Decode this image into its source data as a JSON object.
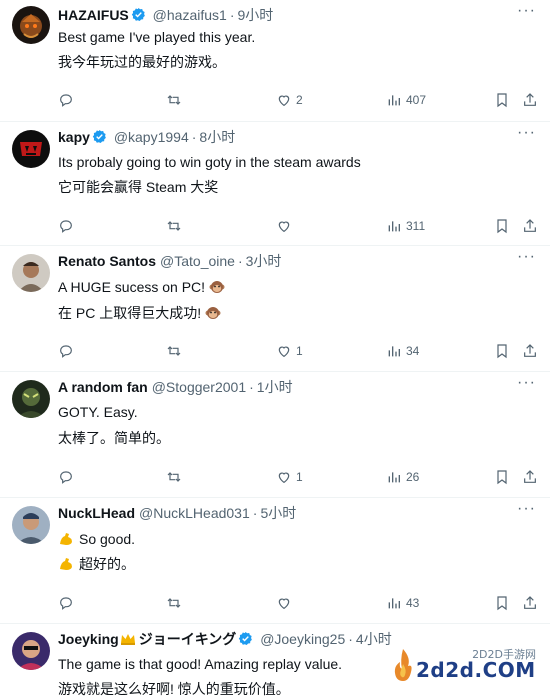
{
  "tweets": [
    {
      "name": "HAZAIFUS",
      "verified": true,
      "handle": "@hazaifus1",
      "time": "9小时",
      "text_en": "Best game I've played this year.",
      "text_zh": "我今年玩过的最好的游戏。",
      "likes": "2",
      "views": "407",
      "emoji": ""
    },
    {
      "name": "kapy",
      "verified": true,
      "handle": "@kapy1994",
      "time": "8小时",
      "text_en": "Its probaly going to win goty in the steam awards",
      "text_zh": "它可能会赢得 Steam 大奖",
      "likes": "",
      "views": "311",
      "emoji": ""
    },
    {
      "name": "Renato Santos",
      "verified": false,
      "handle": "@Tato_oine",
      "time": "3小时",
      "text_en": "A HUGE sucess on PC!",
      "text_zh": "在 PC 上取得巨大成功!",
      "likes": "1",
      "views": "34",
      "emoji": "monkey"
    },
    {
      "name": "A random fan",
      "verified": false,
      "handle": "@Stogger2001",
      "time": "1小时",
      "text_en": "GOTY. Easy.",
      "text_zh": "太棒了。简单的。",
      "likes": "1",
      "views": "26",
      "emoji": ""
    },
    {
      "name": "NuckLHead",
      "verified": false,
      "handle": "@NuckLHead031",
      "time": "5小时",
      "text_en": "So good.",
      "text_zh": "超好的。",
      "likes": "",
      "views": "43",
      "emoji": "flexed-biceps"
    },
    {
      "name": "Joeyking",
      "verified": true,
      "handle": "@Joeyking25",
      "time": "4小时",
      "name_extra": "ジョーイキング",
      "text_en": "The game is that good! Amazing replay value.",
      "text_zh": "游戏就是这么好啊! 惊人的重玩价值。",
      "likes": "",
      "views": "",
      "emoji": "crown"
    }
  ],
  "watermark": {
    "cn": "2D2D手游网",
    "url": "2d2d.COM"
  },
  "icons": {
    "reply": "reply-icon",
    "retweet": "retweet-icon",
    "like": "like-icon",
    "views": "views-icon",
    "bookmark": "bookmark-icon",
    "share": "share-icon",
    "more": "more-icon"
  },
  "colors": {
    "verified": "#1d9bf0",
    "muted": "#536471",
    "text": "#0f1419",
    "divider": "#eff3f4"
  }
}
